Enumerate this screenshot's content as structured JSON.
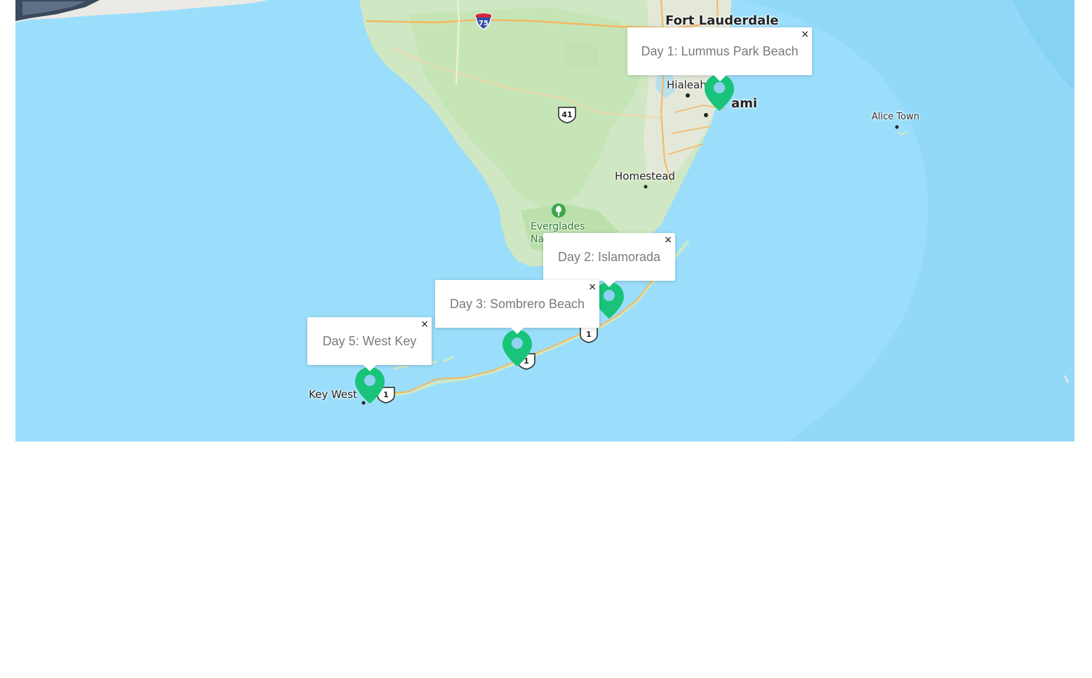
{
  "map": {
    "place_labels": {
      "fort_lauderdale": "Fort Lauderdale",
      "hialeah": "Hialeah",
      "miami": "Miami",
      "miami_visible": "ami",
      "homestead": "Homestead",
      "alice_town": "Alice Town",
      "key_west": "Key West",
      "everglades_line1": "Everglades",
      "everglades_line2": "Nat"
    },
    "road_shields": {
      "i75": "75",
      "us41": "41",
      "us1_a": "1",
      "us1_b": "1",
      "us1_c": "1"
    },
    "popups": [
      {
        "label": "Day 1: Lummus Park Beach",
        "close": "×"
      },
      {
        "label": "Day 2: Islamorada",
        "close": "×"
      },
      {
        "label": "Day 3: Sombrero Beach",
        "close": "×"
      },
      {
        "label": "Day 5: West Key",
        "close": "×"
      }
    ],
    "colors": {
      "water": "#96dcfa",
      "land": "#cfe8c3",
      "land_dark": "#b9dfa8",
      "urban": "#ecebe6",
      "road": "#f4b860",
      "marker": "#19c47a",
      "marker_hole": "#8fd2f0",
      "park_icon": "#3aa64a"
    },
    "icons": {
      "marker": "map-pin-icon",
      "park": "tree-icon",
      "close": "close-icon"
    }
  }
}
